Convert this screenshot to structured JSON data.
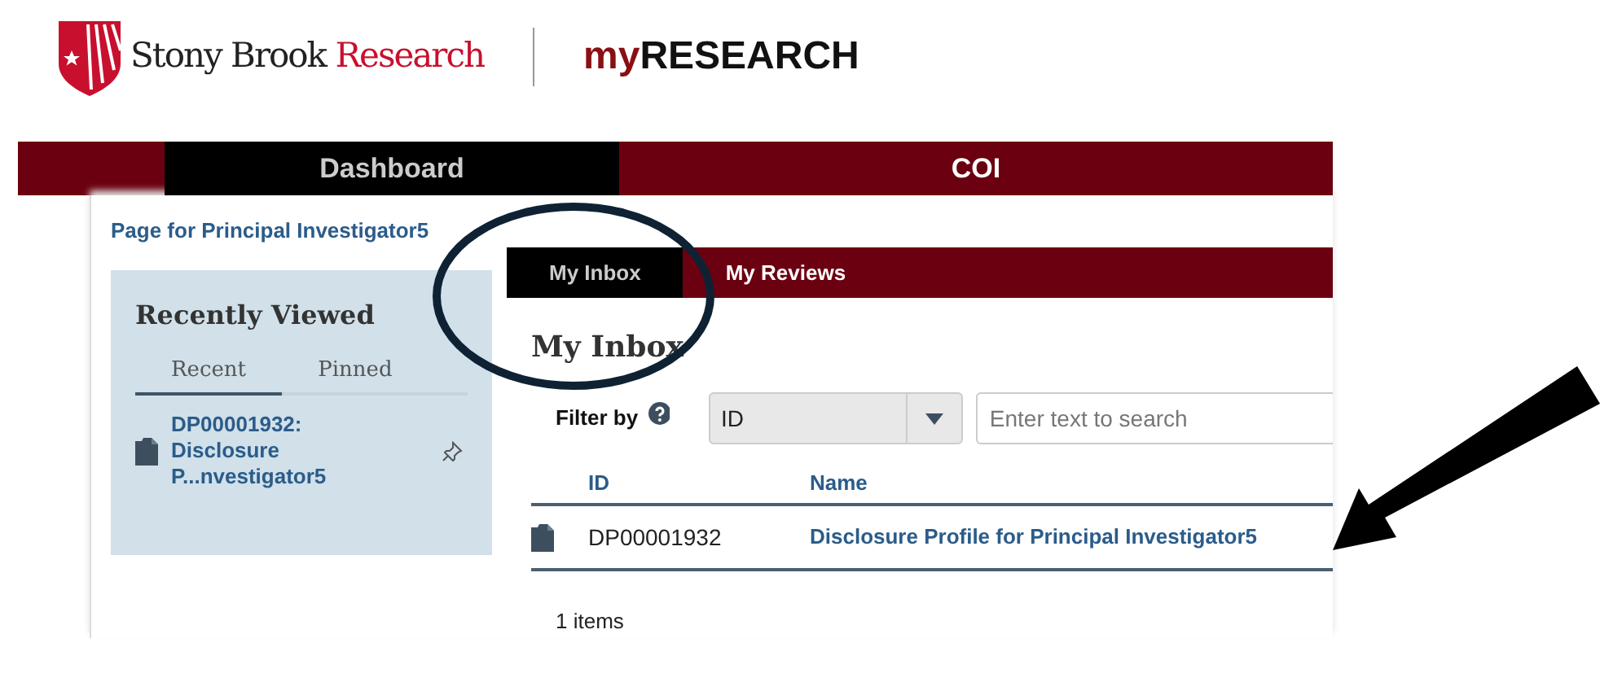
{
  "header": {
    "brand": "Stony Brook",
    "brand_accent": "Research",
    "app_prefix": "my",
    "app_name": "RESEARCH"
  },
  "nav": [
    {
      "label": "Dashboard",
      "selected": true
    },
    {
      "label": "COI",
      "selected": false
    }
  ],
  "breadcrumb": "Page for Principal Investigator5",
  "recently_viewed": {
    "title": "Recently Viewed",
    "tabs": [
      {
        "label": "Recent",
        "selected": true
      },
      {
        "label": "Pinned",
        "selected": false
      }
    ],
    "items": [
      {
        "lines": [
          "DP00001932:",
          "Disclosure",
          "P...nvestigator5"
        ]
      }
    ]
  },
  "inbox": {
    "tabs": [
      {
        "label": "My Inbox",
        "selected": true
      },
      {
        "label": "My Reviews",
        "selected": false
      }
    ],
    "title": "My Inbox",
    "filter_label": "Filter by",
    "filter_value": "ID",
    "search": {
      "placeholder": "Enter text to search"
    },
    "columns": [
      "ID",
      "Name"
    ],
    "rows": [
      {
        "id": "DP00001932",
        "name": "Disclosure Profile for Principal Investigator5"
      }
    ],
    "count": "1 items"
  }
}
